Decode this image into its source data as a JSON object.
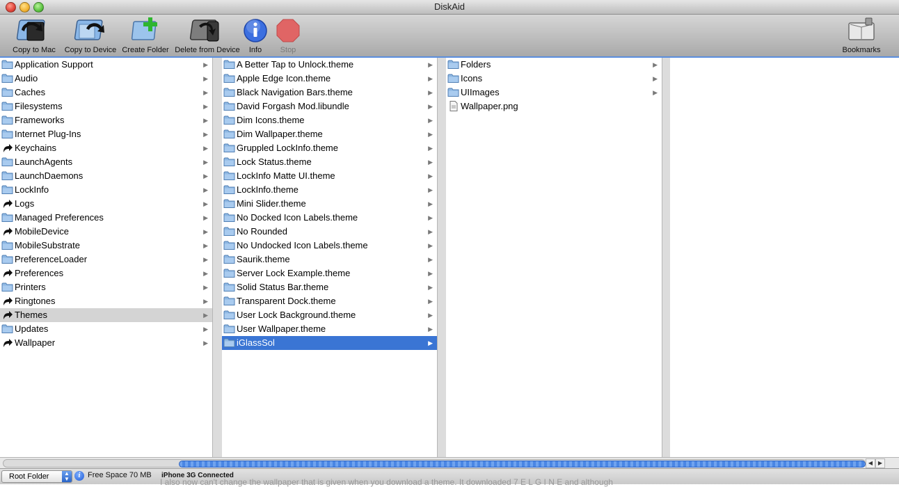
{
  "window": {
    "title": "DiskAid"
  },
  "toolbar": {
    "copy_to_mac": "Copy to Mac",
    "copy_to_device": "Copy to Device",
    "create_folder": "Create Folder",
    "delete_from_device": "Delete from Device",
    "info": "Info",
    "stop": "Stop",
    "bookmarks": "Bookmarks"
  },
  "columns": [
    {
      "items": [
        {
          "label": "Application Support",
          "type": "folder",
          "arrow": true
        },
        {
          "label": "Audio",
          "type": "folder",
          "arrow": true
        },
        {
          "label": "Caches",
          "type": "folder",
          "arrow": true
        },
        {
          "label": "Filesystems",
          "type": "folder",
          "arrow": true
        },
        {
          "label": "Frameworks",
          "type": "folder",
          "arrow": true
        },
        {
          "label": "Internet Plug-Ins",
          "type": "folder",
          "arrow": true
        },
        {
          "label": "Keychains",
          "type": "alias",
          "arrow": true
        },
        {
          "label": "LaunchAgents",
          "type": "folder",
          "arrow": true
        },
        {
          "label": "LaunchDaemons",
          "type": "folder",
          "arrow": true
        },
        {
          "label": "LockInfo",
          "type": "folder",
          "arrow": true
        },
        {
          "label": "Logs",
          "type": "alias",
          "arrow": true
        },
        {
          "label": "Managed Preferences",
          "type": "folder",
          "arrow": true
        },
        {
          "label": "MobileDevice",
          "type": "alias",
          "arrow": true
        },
        {
          "label": "MobileSubstrate",
          "type": "folder",
          "arrow": true
        },
        {
          "label": "PreferenceLoader",
          "type": "folder",
          "arrow": true
        },
        {
          "label": "Preferences",
          "type": "alias",
          "arrow": true
        },
        {
          "label": "Printers",
          "type": "folder",
          "arrow": true
        },
        {
          "label": "Ringtones",
          "type": "alias",
          "arrow": true
        },
        {
          "label": "Themes",
          "type": "alias",
          "arrow": true,
          "selected": "gray"
        },
        {
          "label": "Updates",
          "type": "folder",
          "arrow": true
        },
        {
          "label": "Wallpaper",
          "type": "alias",
          "arrow": true
        }
      ]
    },
    {
      "items": [
        {
          "label": "A Better Tap to Unlock.theme",
          "type": "folder",
          "arrow": true
        },
        {
          "label": "Apple Edge Icon.theme",
          "type": "folder",
          "arrow": true
        },
        {
          "label": "Black Navigation Bars.theme",
          "type": "folder",
          "arrow": true
        },
        {
          "label": "David Forgash Mod.libundle",
          "type": "folder",
          "arrow": true
        },
        {
          "label": "Dim Icons.theme",
          "type": "folder",
          "arrow": true
        },
        {
          "label": "Dim Wallpaper.theme",
          "type": "folder",
          "arrow": true
        },
        {
          "label": "Gruppled LockInfo.theme",
          "type": "folder",
          "arrow": true
        },
        {
          "label": "Lock Status.theme",
          "type": "folder",
          "arrow": true
        },
        {
          "label": "LockInfo Matte UI.theme",
          "type": "folder",
          "arrow": true
        },
        {
          "label": "LockInfo.theme",
          "type": "folder",
          "arrow": true
        },
        {
          "label": "Mini Slider.theme",
          "type": "folder",
          "arrow": true
        },
        {
          "label": "No Docked Icon Labels.theme",
          "type": "folder",
          "arrow": true
        },
        {
          "label": "No Rounded",
          "type": "folder",
          "arrow": true
        },
        {
          "label": "No Undocked Icon Labels.theme",
          "type": "folder",
          "arrow": true
        },
        {
          "label": "Saurik.theme",
          "type": "folder",
          "arrow": true
        },
        {
          "label": "Server Lock Example.theme",
          "type": "folder",
          "arrow": true
        },
        {
          "label": "Solid Status Bar.theme",
          "type": "folder",
          "arrow": true
        },
        {
          "label": "Transparent Dock.theme",
          "type": "folder",
          "arrow": true
        },
        {
          "label": "User Lock Background.theme",
          "type": "folder",
          "arrow": true
        },
        {
          "label": "User Wallpaper.theme",
          "type": "folder",
          "arrow": true
        },
        {
          "label": "iGlassSol",
          "type": "folder",
          "arrow": true,
          "selected": "blue"
        }
      ]
    },
    {
      "items": [
        {
          "label": "Folders",
          "type": "folder",
          "arrow": true
        },
        {
          "label": "Icons",
          "type": "folder",
          "arrow": true
        },
        {
          "label": "UIImages",
          "type": "folder",
          "arrow": true
        },
        {
          "label": "Wallpaper.png",
          "type": "file",
          "arrow": false
        }
      ]
    }
  ],
  "status": {
    "root_folder": "Root Folder",
    "free_space": "Free Space 70 MB",
    "connection": "iPhone 3G Connected",
    "info_glyph": "i"
  },
  "background_text": "I also now can't change the wallpaper that is given when you download a theme. It downloaded 7 E L G I N E and although",
  "colors": {
    "selection_blue": "#3a75d4",
    "selection_gray": "#d4d4d4",
    "accent_rule": "#5a8ede",
    "stop_red": "#e06565"
  }
}
